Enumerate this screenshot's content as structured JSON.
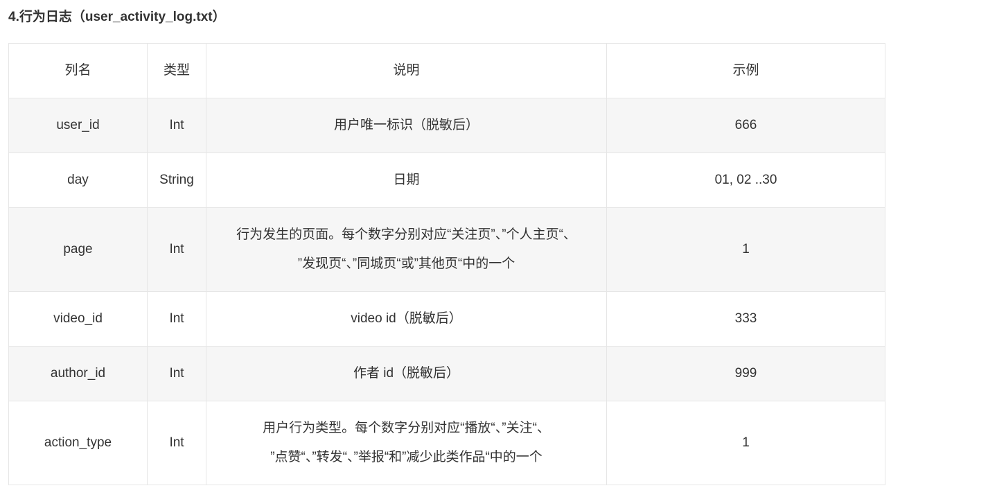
{
  "section_title": "4.行为日志（user_activity_log.txt）",
  "table": {
    "headers": [
      "列名",
      "类型",
      "说明",
      "示例"
    ],
    "rows": [
      {
        "column": "user_id",
        "type": "Int",
        "description": "用户唯一标识（脱敏后）",
        "example": "666"
      },
      {
        "column": "day",
        "type": "String",
        "description": "日期",
        "example": "01, 02 ..30"
      },
      {
        "column": "page",
        "type": "Int",
        "description_lines": [
          "行为发生的页面。每个数字分别对应“关注页”、”个人主页“、",
          "”发现页“、”同城页“或”其他页“中的一个"
        ],
        "example": "1"
      },
      {
        "column": "video_id",
        "type": "Int",
        "description": "video id（脱敏后）",
        "example": "333"
      },
      {
        "column": "author_id",
        "type": "Int",
        "description": "作者 id（脱敏后）",
        "example": "999"
      },
      {
        "column": "action_type",
        "type": "Int",
        "description_lines": [
          "用户行为类型。每个数字分别对应“播放“、”关注“、",
          "”点赞“、”转发“、”举报“和”减少此类作品“中的一个"
        ],
        "example": "1"
      }
    ]
  }
}
